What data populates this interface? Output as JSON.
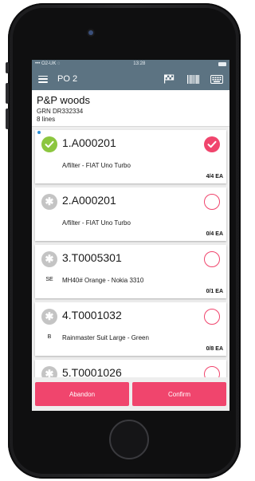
{
  "status_bar": {
    "carrier": "O2-UK",
    "time": "13:28"
  },
  "app_bar": {
    "title": "PO 2",
    "icons": [
      "menu-icon",
      "checkered-flag-icon",
      "barcode-icon",
      "keyboard-icon"
    ]
  },
  "header": {
    "name": "P&P woods",
    "grn": "GRN DR332334",
    "lines": "8 lines"
  },
  "items": [
    {
      "code": "1.A000201",
      "prefix": "",
      "desc": "A/filter - FIAT Uno Turbo",
      "qty": "4/4 EA",
      "status": "received",
      "checked": true,
      "new": true
    },
    {
      "code": "2.A000201",
      "prefix": "",
      "desc": "A/filter - FIAT Uno Turbo",
      "qty": "0/4 EA",
      "status": "pending",
      "checked": false,
      "new": false
    },
    {
      "code": "3.T0005301",
      "prefix": "SE",
      "desc": "MH40# Orange - Nokia 3310",
      "qty": "0/1 EA",
      "status": "pending",
      "checked": false,
      "new": false
    },
    {
      "code": "4.T0001032",
      "prefix": "B",
      "desc": "Rainmaster Suit Large - Green",
      "qty": "0/8 EA",
      "status": "pending",
      "checked": false,
      "new": false
    },
    {
      "code": "5.T0001026",
      "prefix": "",
      "desc": "",
      "qty": "",
      "status": "pending",
      "checked": false,
      "new": false
    }
  ],
  "footer": {
    "abandon_label": "Abandon",
    "confirm_label": "Confirm"
  },
  "colors": {
    "accent": "#f0456d",
    "appbar": "#5c7382",
    "ok": "#8cc63f",
    "pending": "#c4c4c4",
    "new_dot": "#2b8fd6"
  }
}
